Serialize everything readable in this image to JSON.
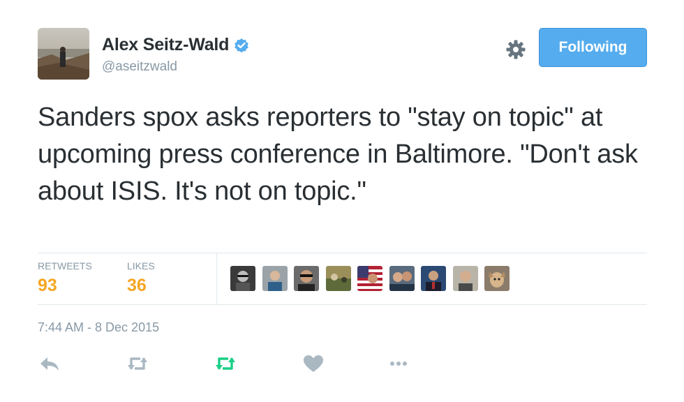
{
  "user": {
    "name": "Alex Seitz-Wald",
    "handle": "@aseitzwald",
    "verified": true
  },
  "follow_button": {
    "label": "Following"
  },
  "tweet": {
    "text": "Sanders spox asks reporters to \"stay on topic\" at upcoming press conference in Baltimore. \"Don't ask about ISIS. It's not on topic.\""
  },
  "stats": {
    "retweets": {
      "label": "RETWEETS",
      "value": "93"
    },
    "likes": {
      "label": "LIKES",
      "value": "36"
    }
  },
  "timestamp": "7:44 AM - 8 Dec 2015",
  "icons": [
    "gear-icon",
    "reply-icon",
    "retweet-icon",
    "retweet-done-icon",
    "like-icon",
    "more-icon",
    "verified-badge-icon"
  ],
  "colors": {
    "accent": "#55acee",
    "stat_value": "#f5a623",
    "muted": "#8899a6",
    "retweet_active": "#19cf86"
  }
}
